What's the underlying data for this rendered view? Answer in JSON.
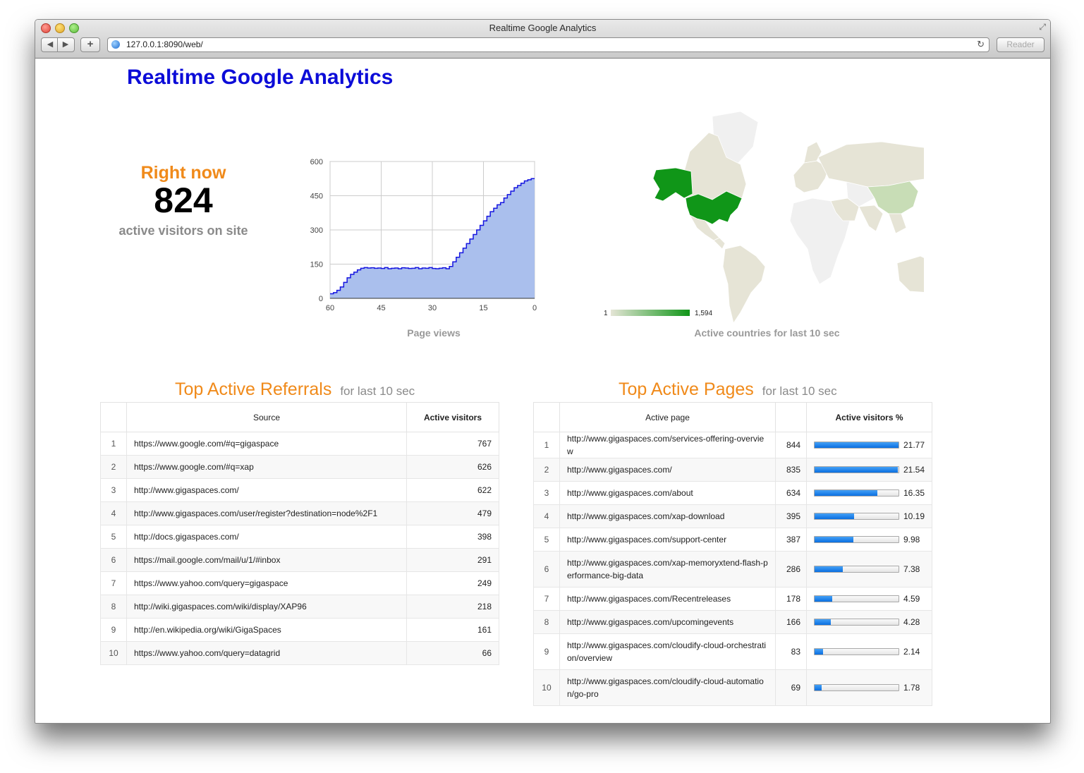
{
  "window": {
    "title": "Realtime Google Analytics",
    "url": "127.0.0.1:8090/web/",
    "reader_label": "Reader",
    "back_label": "◀",
    "forward_label": "▶",
    "add_label": "+"
  },
  "page_title": "Realtime Google Analytics",
  "right_now": {
    "label": "Right now",
    "value": "824",
    "sub": "active visitors on site"
  },
  "chart_data": {
    "type": "area",
    "title": "",
    "caption": "Page views",
    "xlabel": "",
    "ylabel": "",
    "x_ticks": [
      "60",
      "45",
      "30",
      "15",
      "0"
    ],
    "y_ticks": [
      "0",
      "150",
      "300",
      "450",
      "600"
    ],
    "xlim": [
      60,
      0
    ],
    "ylim": [
      0,
      600
    ],
    "grid": true,
    "series": [
      {
        "x": [
          60,
          59,
          58,
          57,
          56,
          55,
          54,
          53,
          52,
          51,
          50,
          49,
          48,
          47,
          46,
          45,
          44,
          43,
          42,
          41,
          40,
          39,
          38,
          37,
          36,
          35,
          34,
          33,
          32,
          31,
          30,
          29,
          28,
          27,
          26,
          25,
          24,
          23,
          22,
          21,
          20,
          19,
          18,
          17,
          16,
          15,
          14,
          13,
          12,
          11,
          10,
          9,
          8,
          7,
          6,
          5,
          4,
          3,
          2,
          1,
          0
        ],
        "values": [
          20,
          25,
          35,
          50,
          70,
          90,
          105,
          115,
          125,
          132,
          135,
          133,
          134,
          132,
          133,
          131,
          135,
          130,
          132,
          133,
          130,
          134,
          133,
          131,
          132,
          135,
          130,
          133,
          132,
          135,
          131,
          130,
          132,
          134,
          130,
          140,
          160,
          180,
          200,
          220,
          240,
          260,
          280,
          300,
          320,
          340,
          360,
          380,
          395,
          410,
          420,
          440,
          455,
          470,
          485,
          495,
          505,
          515,
          520,
          525,
          525
        ]
      }
    ]
  },
  "map": {
    "caption": "Active countries for last 10 sec",
    "legend_min": "1",
    "legend_max": "1,594",
    "low_color": "#e5e5d6",
    "high_color": "#109618"
  },
  "referrals": {
    "title": "Top Active Referrals",
    "suffix": "for last 10 sec",
    "headers": [
      "",
      "Source",
      "Active visitors"
    ],
    "rows": [
      {
        "rank": "1",
        "source": "https://www.google.com/#q=gigaspace",
        "visitors": "767"
      },
      {
        "rank": "2",
        "source": "https://www.google.com/#q=xap",
        "visitors": "626"
      },
      {
        "rank": "3",
        "source": "http://www.gigaspaces.com/",
        "visitors": "622"
      },
      {
        "rank": "4",
        "source": "http://www.gigaspaces.com/user/register?destination=node%2F1",
        "visitors": "479"
      },
      {
        "rank": "5",
        "source": "http://docs.gigaspaces.com/",
        "visitors": "398"
      },
      {
        "rank": "6",
        "source": "https://mail.google.com/mail/u/1/#inbox",
        "visitors": "291"
      },
      {
        "rank": "7",
        "source": "https://www.yahoo.com/query=gigaspace",
        "visitors": "249"
      },
      {
        "rank": "8",
        "source": "http://wiki.gigaspaces.com/wiki/display/XAP96",
        "visitors": "218"
      },
      {
        "rank": "9",
        "source": "http://en.wikipedia.org/wiki/GigaSpaces",
        "visitors": "161"
      },
      {
        "rank": "10",
        "source": "https://www.yahoo.com/query=datagrid",
        "visitors": "66"
      }
    ]
  },
  "pages": {
    "title": "Top Active Pages",
    "suffix": "for last 10 sec",
    "headers": [
      "",
      "Active page",
      "",
      "Active visitors %"
    ],
    "rows": [
      {
        "rank": "1",
        "page": "http://www.gigaspaces.com/services-offering-overview",
        "count": "844",
        "pct": "21.77",
        "fraction": 1.0
      },
      {
        "rank": "2",
        "page": "http://www.gigaspaces.com/",
        "count": "835",
        "pct": "21.54",
        "fraction": 0.989
      },
      {
        "rank": "3",
        "page": "http://www.gigaspaces.com/about",
        "count": "634",
        "pct": "16.35",
        "fraction": 0.751
      },
      {
        "rank": "4",
        "page": "http://www.gigaspaces.com/xap-download",
        "count": "395",
        "pct": "10.19",
        "fraction": 0.468
      },
      {
        "rank": "5",
        "page": "http://www.gigaspaces.com/support-center",
        "count": "387",
        "pct": "9.98",
        "fraction": 0.458
      },
      {
        "rank": "6",
        "page": "http://www.gigaspaces.com/xap-memoryxtend-flash-performance-big-data",
        "count": "286",
        "pct": "7.38",
        "fraction": 0.339
      },
      {
        "rank": "7",
        "page": "http://www.gigaspaces.com/Recentreleases",
        "count": "178",
        "pct": "4.59",
        "fraction": 0.211
      },
      {
        "rank": "8",
        "page": "http://www.gigaspaces.com/upcomingevents",
        "count": "166",
        "pct": "4.28",
        "fraction": 0.197
      },
      {
        "rank": "9",
        "page": "http://www.gigaspaces.com/cloudify-cloud-orchestration/overview",
        "count": "83",
        "pct": "2.14",
        "fraction": 0.098
      },
      {
        "rank": "10",
        "page": "http://www.gigaspaces.com/cloudify-cloud-automation/go-pro",
        "count": "69",
        "pct": "1.78",
        "fraction": 0.082
      }
    ]
  }
}
